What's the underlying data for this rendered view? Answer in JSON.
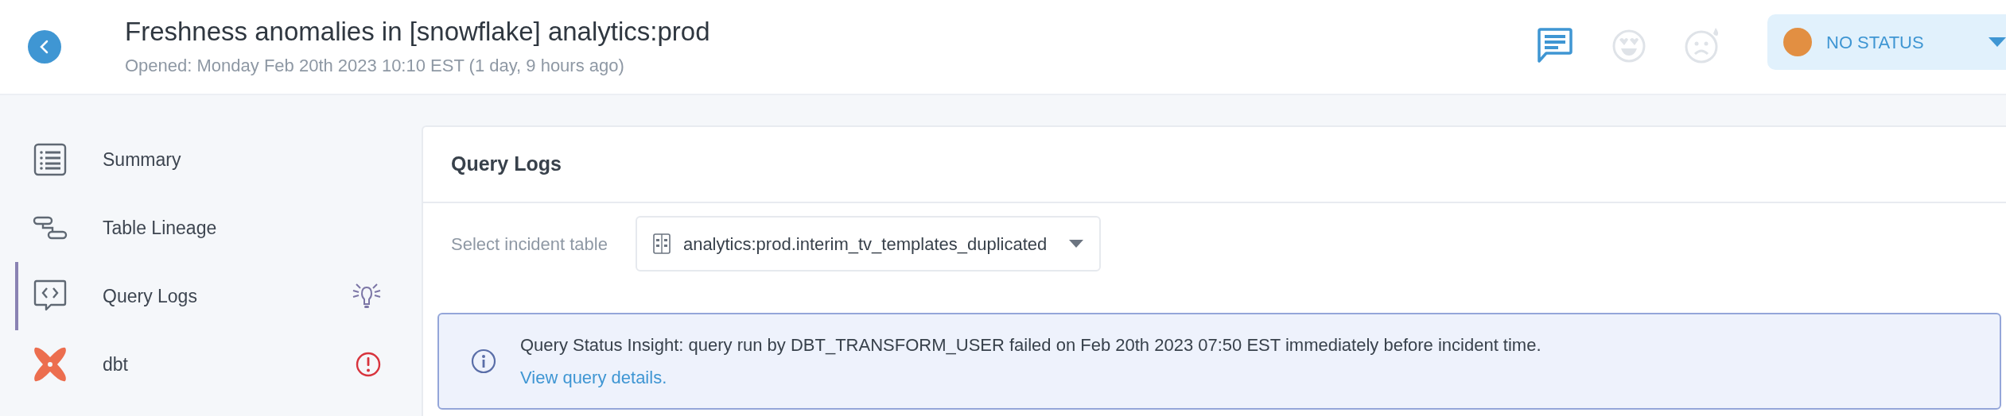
{
  "header": {
    "title": "Freshness anomalies in [snowflake] analytics:prod",
    "subtitle": "Opened: Monday Feb 20th 2023 10:10 EST (1 day, 9 hours ago)",
    "status": {
      "label": "NO STATUS",
      "color": "#e28f42"
    }
  },
  "sidebar": {
    "items": [
      {
        "label": "Summary",
        "selected": false
      },
      {
        "label": "Table Lineage",
        "selected": false
      },
      {
        "label": "Query Logs",
        "selected": true
      },
      {
        "label": "dbt",
        "selected": false
      }
    ]
  },
  "panel": {
    "title": "Query Logs",
    "select_label": "Select incident table",
    "select_value": "analytics:prod.interim_tv_templates_duplicated",
    "insight": {
      "text": "Query Status Insight: query run by DBT_TRANSFORM_USER failed on Feb 20th 2023 07:50 EST immediately before incident time.",
      "link": "View query details."
    }
  }
}
